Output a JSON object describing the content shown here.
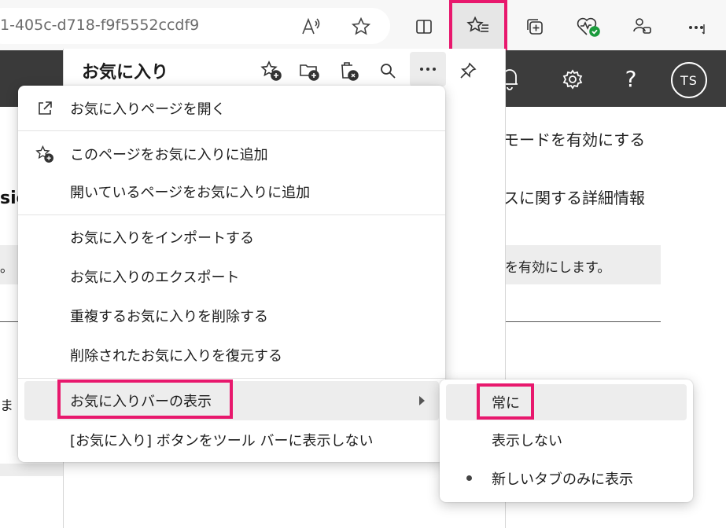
{
  "address_bar": {
    "url": "1-405c-d718-f9f5552ccdf9"
  },
  "toolbar_icons": [
    "read-aloud-icon",
    "add-favorite-star-icon",
    "split-screen-icon",
    "favorites-icon",
    "collections-icon",
    "browser-essentials-icon",
    "copilot-icon",
    "more-icon"
  ],
  "favorites_panel": {
    "title": "お気に入り"
  },
  "background_page": {
    "left_fragment": "sio",
    "left_fragment_2": "ま",
    "left_fragment_3": "。",
    "right_line_1": "モードを有効にする",
    "right_line_2": "スに関する詳細情報",
    "right_box": "を有効にします。",
    "avatar": "TS"
  },
  "menu": {
    "open_favorites_page": "お気に入りページを開く",
    "add_this_page": "このページをお気に入りに追加",
    "add_open_pages": "開いているページをお気に入りに追加",
    "import": "お気に入りをインポートする",
    "export": "お気に入りのエクスポート",
    "remove_duplicates": "重複するお気に入りを削除する",
    "restore_deleted": "削除されたお気に入りを復元する",
    "show_favorites_bar": "お気に入りバーの表示",
    "hide_button": "[お気に入り] ボタンをツール バーに表示しない"
  },
  "submenu": {
    "always": "常に",
    "never": "表示しない",
    "new_tab_only": "新しいタブのみに表示",
    "selected": "new_tab_only"
  },
  "colors": {
    "highlight": "#e8186d",
    "header_dark": "#3c3c3c"
  }
}
